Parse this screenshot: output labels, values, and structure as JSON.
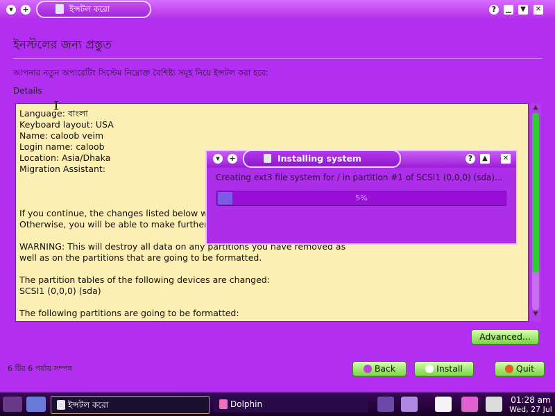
{
  "window": {
    "title": "ইন্সটল করো"
  },
  "page": {
    "heading": "ইনস্টলের জন্য প্রস্তুত",
    "subtext": "আপনার নতুন অপারেটিং সিস্টেম নিম্নোক্ত বৈশিষ্ট্য সমূহ নিয়ে ইন্সটল করা হবে:",
    "details_label": "Details",
    "details_lines": [
      "Language: বাংলা",
      "Keyboard layout: USA",
      "Name: caloob veim",
      "Login name: caloob",
      "Location: Asia/Dhaka",
      "Migration Assistant:",
      "",
      "",
      "",
      "If you continue, the changes listed below wil",
      "Otherwise, you will be able to make further c",
      "",
      "WARNING: This will destroy all data on any partitions you have removed as",
      "well as on the partitions that are going to be formatted.",
      "",
      "The partition tables of the following devices are changed:",
      "SCSI1 (0,0,0) (sda)",
      "",
      "The following partitions are going to be formatted:"
    ],
    "advanced_label": "Advanced...",
    "step_text": "6 টির 6 পর্যায় সম্পন্ন",
    "back_label": "Back",
    "install_label": "Install",
    "quit_label": "Quit"
  },
  "dialog": {
    "title": "Installing system",
    "status": "Creating ext3 file system for / in partition #1 of SCSI1 (0,0,0) (sda)...",
    "progress": 5,
    "progress_text": "5%"
  },
  "taskbar": {
    "tasks": [
      {
        "label": "ইন্সটল করো"
      },
      {
        "label": "Dolphin"
      }
    ],
    "clock_time": "01:28 am",
    "clock_date": "Wed, 27 Jul"
  },
  "colors": {
    "background": "#b22ef0",
    "details_bg": "#fcefb4",
    "button_green": "#7ad442",
    "scroll_thumb": "#2fcc2f"
  }
}
